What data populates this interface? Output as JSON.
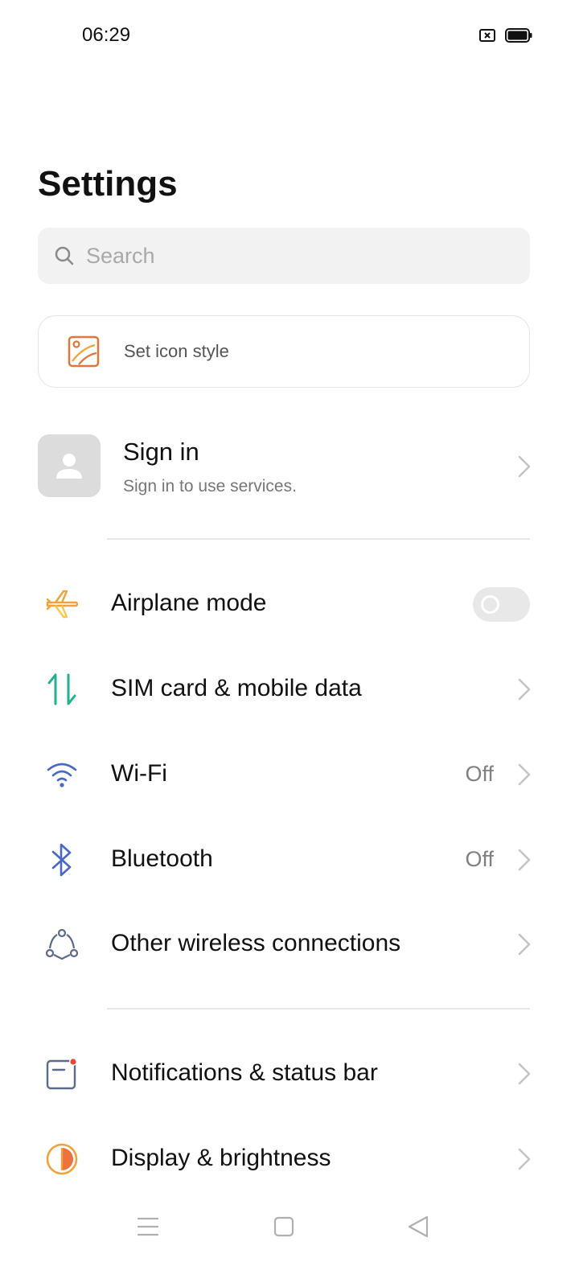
{
  "status_bar": {
    "time": "06:29",
    "icons": [
      "screenshot-blocked-icon",
      "battery-full-icon"
    ]
  },
  "header": {
    "title": "Settings"
  },
  "search": {
    "placeholder": "Search",
    "value": ""
  },
  "icon_style_card": {
    "label": "Set icon style",
    "icon": "image-frame-icon",
    "accent": "#e0773a"
  },
  "account": {
    "title": "Sign in",
    "subtitle": "Sign in to use services.",
    "icon": "user-avatar-icon"
  },
  "connectivity": [
    {
      "id": "airplane",
      "label": "Airplane mode",
      "icon": "airplane-icon",
      "control": "toggle",
      "toggle_on": false
    },
    {
      "id": "sim",
      "label": "SIM card & mobile data",
      "icon": "data-arrows-icon",
      "control": "chevron"
    },
    {
      "id": "wifi",
      "label": "Wi-Fi",
      "value": "Off",
      "icon": "wifi-icon",
      "control": "chevron"
    },
    {
      "id": "bluetooth",
      "label": "Bluetooth",
      "value": "Off",
      "icon": "bluetooth-icon",
      "control": "chevron"
    },
    {
      "id": "wireless",
      "label": "Other wireless connections",
      "icon": "connections-icon",
      "control": "chevron"
    }
  ],
  "device": [
    {
      "id": "notifications",
      "label": "Notifications & status bar",
      "icon": "notification-panel-icon",
      "control": "chevron"
    },
    {
      "id": "display",
      "label": "Display & brightness",
      "icon": "brightness-icon",
      "control": "chevron"
    }
  ],
  "nav_bar": {
    "buttons": [
      "menu-icon",
      "home-icon",
      "back-icon"
    ]
  },
  "colors": {
    "airplane": "#f0a33c",
    "sim": "#23b08f",
    "wifi": "#4a68c8",
    "bluetooth": "#4a68c8",
    "notification_dot": "#e8453c",
    "display": "#f0a33c",
    "chevron": "#c4c4c4"
  }
}
